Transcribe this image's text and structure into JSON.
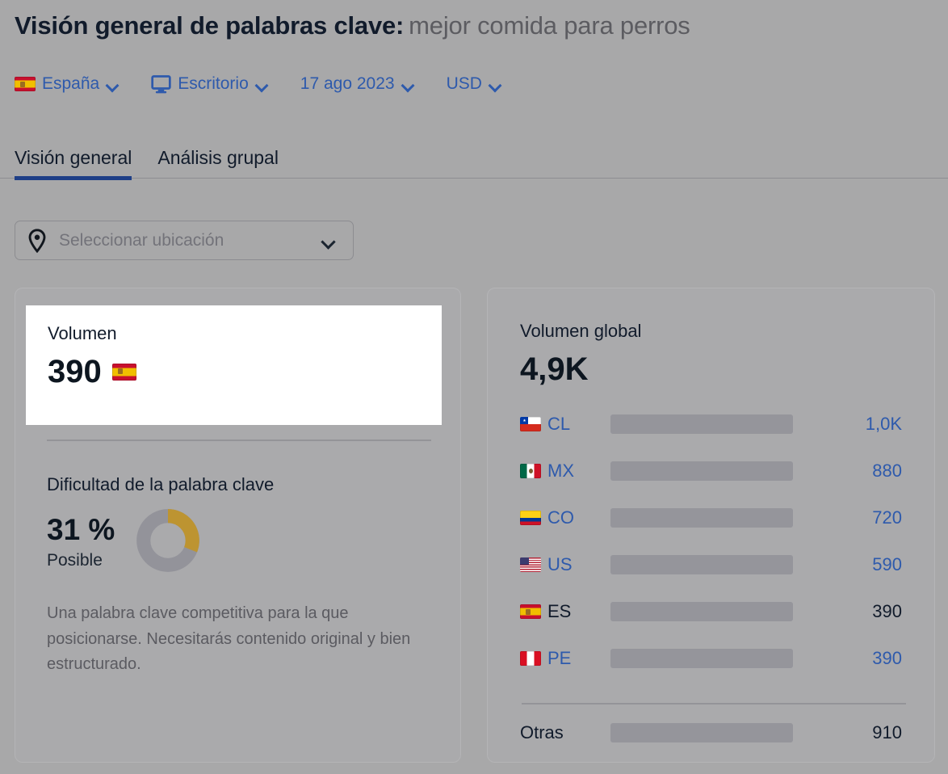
{
  "header": {
    "title_main": "Visión general de palabras clave:",
    "keyword": "mejor comida para perros",
    "filters": [
      {
        "name": "country",
        "label": "España",
        "icon": "flag-es-icon"
      },
      {
        "name": "device",
        "label": "Escritorio",
        "icon": "monitor-icon"
      },
      {
        "name": "date",
        "label": "17 ago 2023",
        "icon": ""
      },
      {
        "name": "currency",
        "label": "USD",
        "icon": ""
      }
    ]
  },
  "tabs": [
    {
      "label": "Visión general",
      "active": true
    },
    {
      "label": "Análisis grupal",
      "active": false
    }
  ],
  "location_select": {
    "placeholder": "Seleccionar ubicación",
    "icon": "map-pin-icon"
  },
  "volume_card": {
    "label": "Volumen",
    "value": "390",
    "flag": "flag-es-icon",
    "difficulty": {
      "title": "Dificultad de la palabra clave",
      "percent_label": "31 %",
      "percent_value": 31,
      "status": "Posible",
      "description": "Una palabra clave competitiva para la que posicionarse. Necesitarás contenido original y bien estructurado.",
      "arc_color": "#bd9431",
      "track_color": "#93939a"
    }
  },
  "global_card": {
    "label": "Volumen global",
    "value": "4,9K",
    "others": {
      "label": "Otras",
      "value": "910",
      "bar_pct": 19.0
    }
  },
  "chart_data": {
    "type": "bar",
    "title": "Volumen global",
    "orientation": "horizontal",
    "total": "4,9K",
    "xlabel": "",
    "ylabel": "",
    "categories": [
      "CL",
      "MX",
      "CO",
      "US",
      "ES",
      "PE",
      "Otras"
    ],
    "values": [
      1000,
      880,
      720,
      590,
      390,
      390,
      910
    ],
    "value_labels": [
      "1,0K",
      "880",
      "720",
      "590",
      "390",
      "390",
      "910"
    ],
    "bar_pcts": [
      20.4,
      18.1,
      15.0,
      12.4,
      8.0,
      8.0,
      19.0
    ],
    "flags": [
      "flag-cl",
      "flag-mx",
      "flag-co",
      "flag-us",
      "flag-es",
      "flag-pe",
      ""
    ],
    "highlighted": "ES",
    "bar_color": "#3d7ab3",
    "bar_color_highlight": "#204a8f",
    "track_color": "#95959b",
    "grid": false,
    "legend": false
  },
  "colors": {
    "page_bg": "#a8a8a9",
    "card_bg": "#aaaaac",
    "accent_blue": "#2e5aac",
    "tab_underline": "#1f3f87",
    "highlight_white": "#ffffff"
  }
}
